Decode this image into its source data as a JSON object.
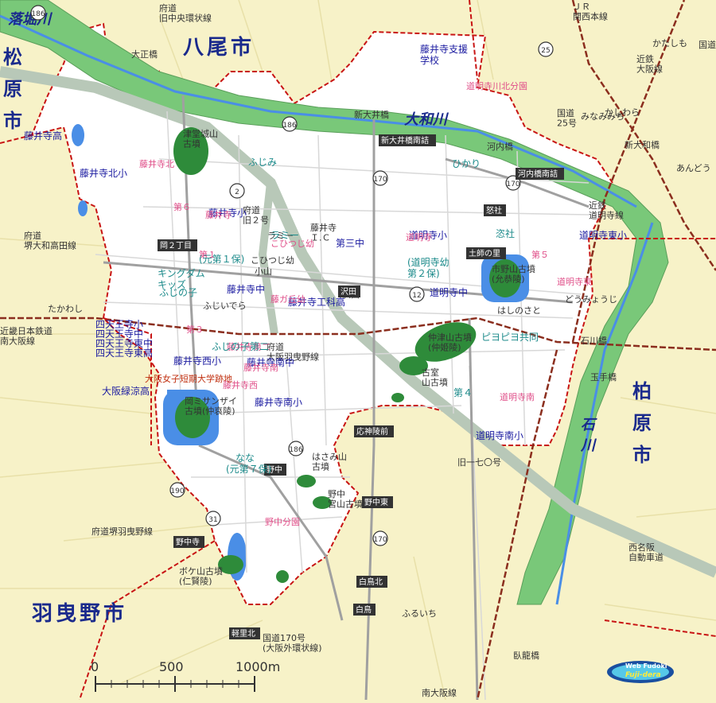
{
  "cities": {
    "yao": "八尾市",
    "matsubara": "松原市",
    "kashiwara": "柏原市",
    "habikino": "羽曳野市"
  },
  "rivers": {
    "yamato": "大和川",
    "ishikawa": "石川",
    "ochibori": "落堀川"
  },
  "roads": [
    "府道\n旧中央環状線",
    "大正橋",
    "新大井橋",
    "国道\n25号",
    "河内橋",
    "国道旧一七〇号",
    "府道\n堺大和高田線",
    "府道\n旧２号",
    "藤井寺\nＩ.Ｃ",
    "府道\n大阪羽曳野線",
    "旧一七〇号",
    "府道堺羽曳野線",
    "国道170号\n(大阪外環状線)",
    "西名阪\n自動車道",
    "石川橋",
    "玉手橋",
    "臥龍橋",
    "南大阪線",
    "近鉄\n大阪線",
    "近鉄\n道明寺線",
    "近畿日本鉄道\n南大阪線",
    "ＪＲ\n関西本線",
    "新大和橋",
    "小山",
    "ラミー",
    "沢田",
    "たかわし",
    "ふじいでら",
    "どうみょうじ",
    "かしわら",
    "かたしも",
    "みなみみち",
    "あんどう",
    "ふるいち",
    "はしのさと",
    "こひつじ幼"
  ],
  "road_numbers": [
    "186",
    "25",
    "170",
    "2",
    "12",
    "190",
    "31"
  ],
  "boxes": [
    "新大井橋南詰",
    "河内橋南詰",
    "怒社",
    "土師の里",
    "岡２丁目",
    "応神陵前",
    "野中東",
    "野中寺",
    "白鳥北",
    "白鳥",
    "軽里北",
    "野中",
    "沢田"
  ],
  "schools": [
    "藤井寺支援\n学校",
    "藤井寺高",
    "藤井寺北小",
    "藤井寺小",
    "第三中",
    "藤井寺中",
    "藤井寺工科高",
    "道明寺中",
    "道明寺小",
    "道明寺東小",
    "藤井寺西小",
    "藤井寺南小",
    "道明寺南小",
    "四天王寺小",
    "四天王寺中",
    "四天王寺東中",
    "四天王寺東高",
    "大阪緑涼高",
    "藤井寺南中"
  ],
  "kindergartens": [
    "道明寺川北分園",
    "藤井寺北",
    "第６",
    "藤井寺",
    "第１",
    "道明寺",
    "第５",
    "道明寺東",
    "第３",
    "藤井寺西",
    "藤井寺南",
    "道明寺南",
    "野中分園",
    "藤井寺第二",
    "こひつじ幼",
    "藤ガ丘幼"
  ],
  "nurseries": [
    "ふじみ",
    "ラミー",
    "キングダム\nキッズ",
    "ふじの子",
    "ふじの子第二",
    "ピヨピヨ共同",
    "第４",
    "ひかり",
    "恣社",
    "なな",
    "(道明寺幼\n第２保)",
    "(元第７保)",
    "(元第１保)"
  ],
  "kofun": [
    "津堂城山\n古墳",
    "仲津山古墳\n(仲姫陵)",
    "古室\n山古墳",
    "岡ミサンザイ\n古墳(仲哀陵)",
    "市野山古墳\n(允恭陵)",
    "はさみ山\n古墳",
    "野中\n宮山古墳",
    "ボケ山古墳\n(仁賢陵)"
  ],
  "misc": [
    "大阪女子短期大学跡地"
  ],
  "scale": {
    "t0": "0",
    "t500": "500",
    "t1000": "1000m"
  },
  "logo": {
    "l1": "Web Fudoki",
    "l2": "Fuji-dera"
  },
  "colors": {
    "land": "#f7f2c8",
    "city": "#ffffff",
    "river": "#79c879",
    "water": "#4a8ee6",
    "kofun": "#2e8b3a",
    "railway": "#8b2e1e",
    "boundary": "#c81414"
  }
}
